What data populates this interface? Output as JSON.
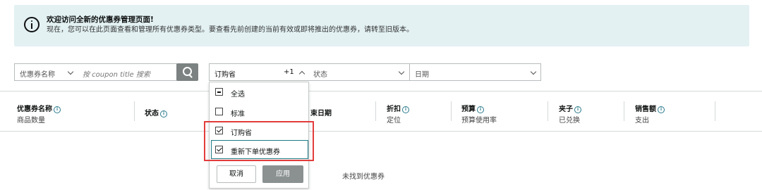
{
  "banner": {
    "title": "欢迎访问全新的优惠券管理页面!",
    "text": "现在，您可以在此页面查看和管理所有优惠券类型。要查看先前创建的当前有效或即将推出的优惠券，请转至旧版本。"
  },
  "filters": {
    "field_select": "优惠券名称",
    "search_placeholder": "按 coupon title 搜索",
    "type_select": "订购省",
    "type_extra": "+1",
    "status_select": "状态",
    "date_select": "日期"
  },
  "table": {
    "columns": [
      {
        "title": "优惠券名称",
        "sub": "商品数量"
      },
      {
        "title": "状态",
        "sub": ""
      },
      {
        "title": "束日期",
        "sub": ""
      },
      {
        "title": "折扣",
        "sub": "定位"
      },
      {
        "title": "预算",
        "sub": "预算使用率"
      },
      {
        "title": "夹子",
        "sub": "已兑换"
      },
      {
        "title": "销售额",
        "sub": "支出"
      }
    ],
    "empty_text": "未找到优惠券"
  },
  "dropdown": {
    "options": [
      {
        "label": "全选",
        "state": "partial"
      },
      {
        "label": "标准",
        "state": "unchecked"
      },
      {
        "label": "订购省",
        "state": "checked"
      },
      {
        "label": "重新下单优惠券",
        "state": "checked"
      }
    ],
    "cancel_label": "取消",
    "apply_label": "应用"
  },
  "colors": {
    "highlight_box": "#e33c3c",
    "apply_bg": "#8b9191",
    "banner_bg": "#e3f1f3"
  }
}
